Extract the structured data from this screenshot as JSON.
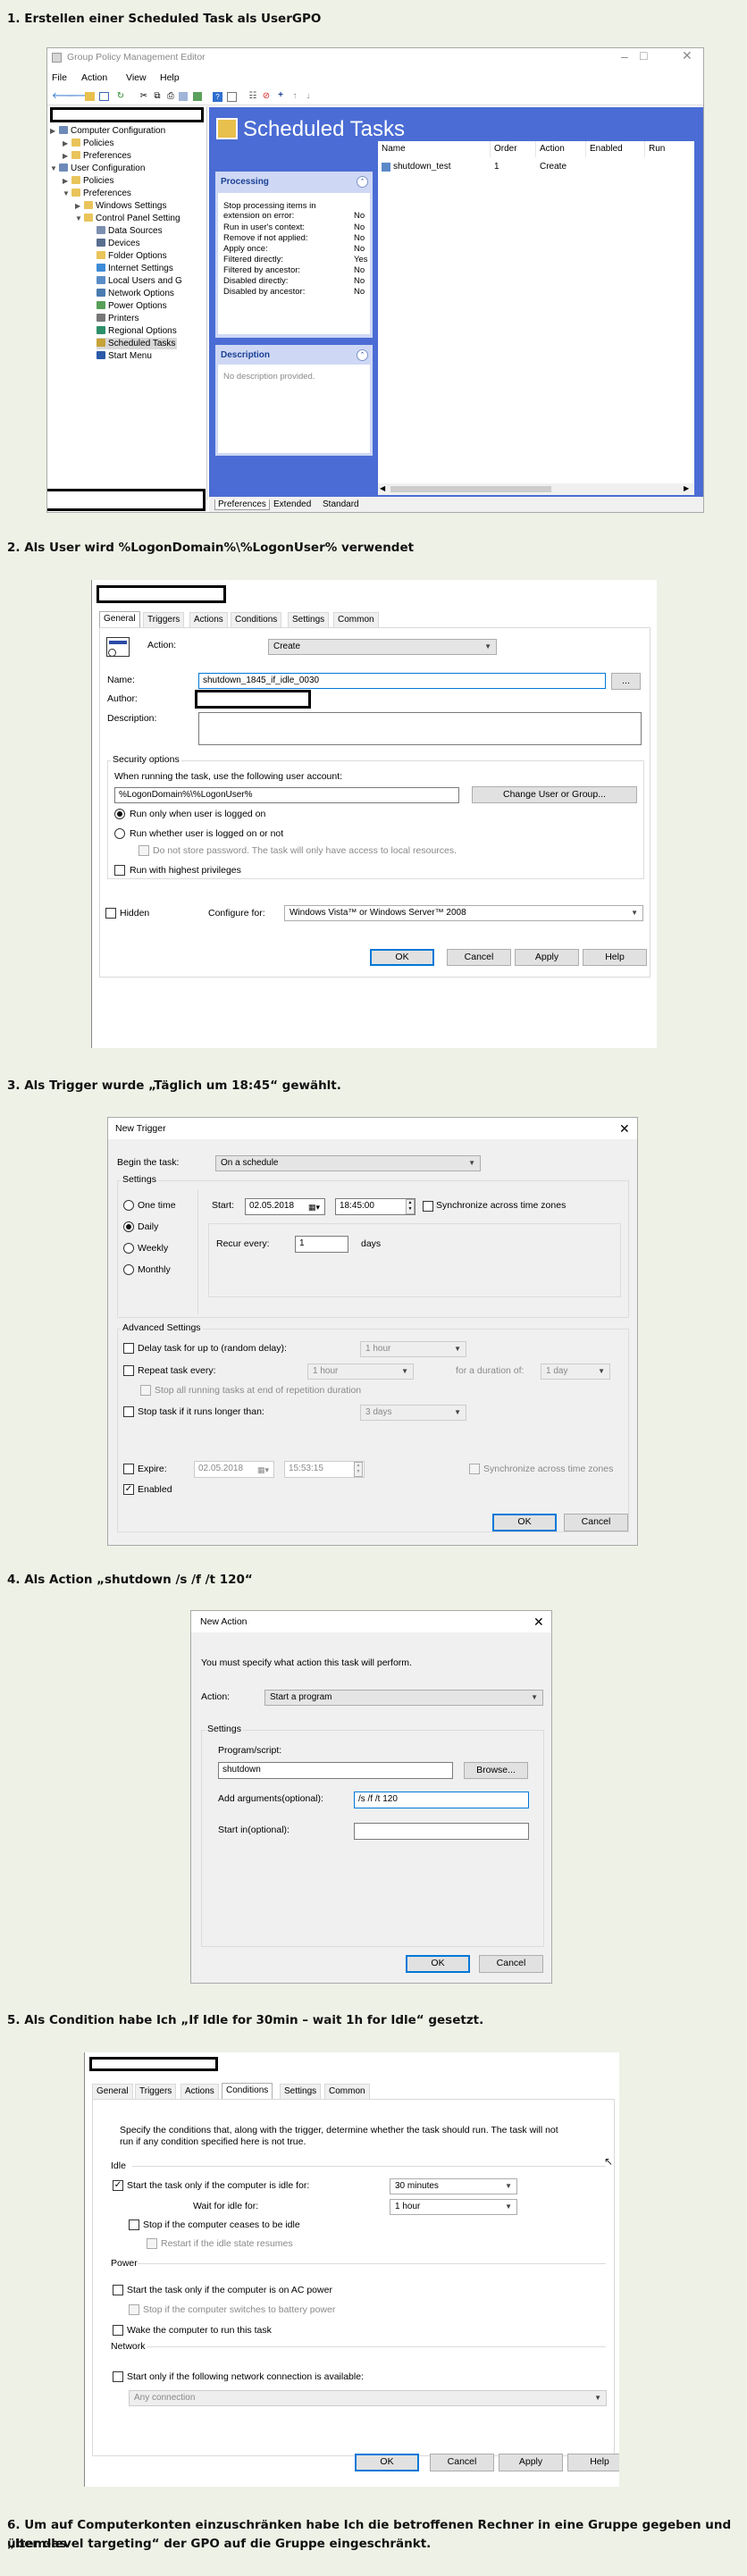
{
  "steps": {
    "s1": "1. Erstellen einer Scheduled Task als UserGPO",
    "s2": "2. Als User wird %LogonDomain%\\%LogonUser% verwendet",
    "s3": "3. Als Trigger wurde „Täglich um 18:45“ gewählt.",
    "s4": "4. Als Action „shutdown /s /f /t 120“",
    "s5": "5. Als Condition habe Ich „If Idle for 30min – wait 1h for Idle“ gesetzt.",
    "s6a": "6. Um auf Computerkonten einzuschränken habe Ich die betroffenen Rechner in eine Gruppe gegeben und über das",
    "s6b": "„Item-level targeting“ der GPO auf die Gruppe eingeschränkt."
  },
  "gpme": {
    "title": "Group Policy Management Editor",
    "menu": [
      "File",
      "Action",
      "View",
      "Help"
    ],
    "tree": {
      "computer_config": "Computer Configuration",
      "policies1": "Policies",
      "preferences1": "Preferences",
      "user_config": "User Configuration",
      "policies2": "Policies",
      "preferences2": "Preferences",
      "windows_settings": "Windows Settings",
      "control_panel": "Control Panel Setting",
      "data_sources": "Data Sources",
      "devices": "Devices",
      "folder_options": "Folder Options",
      "internet_settings": "Internet Settings",
      "local_users": "Local Users and G",
      "network_options": "Network Options",
      "power_options": "Power Options",
      "printers": "Printers",
      "regional_options": "Regional Options",
      "scheduled_tasks": "Scheduled Tasks",
      "start_menu": "Start Menu"
    },
    "header": "Scheduled Tasks",
    "processing": {
      "title": "Processing",
      "rows": [
        [
          "Stop processing items in extension on error:",
          "No"
        ],
        [
          "Run in user's context:",
          "No"
        ],
        [
          "Remove if not applied:",
          "No"
        ],
        [
          "Apply once:",
          "No"
        ],
        [
          "Filtered directly:",
          "Yes"
        ],
        [
          "Filtered by ancestor:",
          "No"
        ],
        [
          "Disabled directly:",
          "No"
        ],
        [
          "Disabled by ancestor:",
          "No"
        ]
      ]
    },
    "description": {
      "title": "Description",
      "text": "No description provided."
    },
    "columns": [
      "Name",
      "Order",
      "Action",
      "Enabled",
      "Run"
    ],
    "row": {
      "name": "shutdown_test",
      "order": "1",
      "action": "Create",
      "enabled": "",
      "run": ""
    },
    "bottom_tabs": [
      "Preferences",
      "Extended",
      "Standard"
    ]
  },
  "props": {
    "tabs": [
      "General",
      "Triggers",
      "Actions",
      "Conditions",
      "Settings",
      "Common"
    ],
    "action_label": "Action:",
    "action_value": "Create",
    "name_label": "Name:",
    "name_value": "shutdown_1845_if_idle_0030",
    "browse": "...",
    "author_label": "Author:",
    "description_label": "Description:",
    "security_title": "Security options",
    "account_label": "When running the task, use the following user account:",
    "account_value": "%LogonDomain%\\%LogonUser%",
    "change_user": "Change User or Group...",
    "run_logged_on": "Run only when user is logged on",
    "run_whether": "Run whether user is logged on or not",
    "no_store_pw": "Do not store password. The task will only have access to local resources.",
    "highest": "Run with highest privileges",
    "hidden": "Hidden",
    "configure_label": "Configure for:",
    "configure_value": "Windows Vista™ or Windows Server™ 2008",
    "ok": "OK",
    "cancel": "Cancel",
    "apply": "Apply",
    "help": "Help"
  },
  "trigger": {
    "title": "New Trigger",
    "begin_label": "Begin the task:",
    "begin_value": "On a schedule",
    "settings": "Settings",
    "one_time": "One time",
    "daily": "Daily",
    "weekly": "Weekly",
    "monthly": "Monthly",
    "start_label": "Start:",
    "start_date": "02.05.2018",
    "start_time": "18:45:00",
    "sync": "Synchronize across time zones",
    "recur_label": "Recur every:",
    "recur_value": "1",
    "days": "days",
    "advanced": "Advanced Settings",
    "delay_label": "Delay task for up to (random delay):",
    "delay_value": "1 hour",
    "repeat_label": "Repeat task every:",
    "repeat_value": "1 hour",
    "duration_label": "for a duration of:",
    "duration_value": "1 day",
    "stop_running": "Stop all running tasks at end of repetition duration",
    "stop_longer": "Stop task if it runs longer than:",
    "stop_value": "3 days",
    "expire": "Expire:",
    "expire_date": "02.05.2018",
    "expire_time": "15:53:15",
    "sync2": "Synchronize across time zones",
    "enabled": "Enabled",
    "ok": "OK",
    "cancel": "Cancel"
  },
  "action": {
    "title": "New Action",
    "intro": "You must specify what action this task will perform.",
    "action_label": "Action:",
    "action_value": "Start a program",
    "settings": "Settings",
    "program_label": "Program/script:",
    "program_value": "shutdown",
    "browse": "Browse...",
    "args_label": "Add arguments(optional):",
    "args_value": "/s /f /t 120",
    "start_in": "Start in(optional):",
    "ok": "OK",
    "cancel": "Cancel"
  },
  "conditions": {
    "tabs": [
      "General",
      "Triggers",
      "Actions",
      "Conditions",
      "Settings",
      "Common"
    ],
    "intro1": "Specify the conditions that, along with the trigger, determine whether the task should run. The task will not",
    "intro2": "run if any condition specified here is not true.",
    "idle": "Idle",
    "idle_start": "Start the task only if the computer is idle for:",
    "idle_value": "30 minutes",
    "wait_label": "Wait for idle for:",
    "wait_value": "1 hour",
    "stop_idle": "Stop if the computer ceases to be idle",
    "restart": "Restart if the idle state resumes",
    "power": "Power",
    "ac": "Start the task only if the computer is on AC power",
    "battery": "Stop if the computer switches to battery power",
    "wake": "Wake the computer to run this task",
    "network": "Network",
    "net_start": "Start only if the following network connection is available:",
    "net_value": "Any connection",
    "ok": "OK",
    "cancel": "Cancel",
    "apply": "Apply",
    "help": "Help"
  },
  "colors": {
    "accent": "#0078d7",
    "gpme_blue": "#4a6cd4",
    "panel_bg": "#ced8f5"
  }
}
